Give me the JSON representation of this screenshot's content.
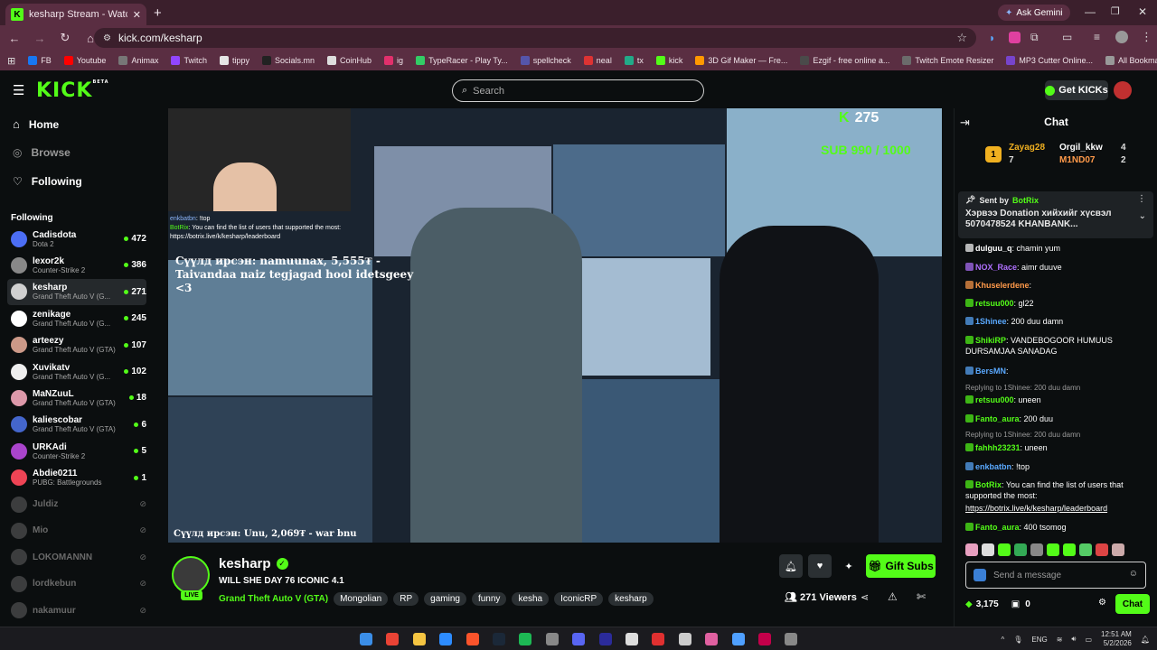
{
  "browser": {
    "tab_title": "kesharp Stream - Watch Liv",
    "tab_favicon": "K",
    "gemini": "Ask Gemini",
    "url": "kick.com/kesharp",
    "bookmarks": [
      "FB",
      "Youtube",
      "Animax",
      "Twitch",
      "tippy",
      "Socials.mn",
      "CoinHub",
      "ig",
      "TypeRacer - Play Ty...",
      "spellcheck",
      "neal",
      "tx",
      "kick",
      "3D Gif Maker — Fre...",
      "Ezgif - free online a...",
      "Twitch Emote Resizer",
      "MP3 Cutter Online...",
      "All Bookmarks"
    ],
    "bookmark_colors": [
      "#1877f2",
      "#ff0000",
      "#777",
      "#9146ff",
      "#e5e5e5",
      "#222",
      "#ddd",
      "#e1306c",
      "#3c6",
      "#55a",
      "#d33",
      "#2a8",
      "#53fc18",
      "#ff9800",
      "#4a4a4a",
      "#6b6b6b",
      "#7744cc",
      "#999"
    ]
  },
  "header": {
    "logo": "KICK",
    "logo_sup": "BETA",
    "search_placeholder": "Search",
    "get_kicks": "Get KICKs"
  },
  "sidebar": {
    "nav": [
      "Home",
      "Browse",
      "Following"
    ],
    "following_heading": "Following",
    "channels": [
      {
        "name": "Cadisdota",
        "game": "Dota 2",
        "viewers": "472",
        "color": "#4c6ef5"
      },
      {
        "name": "lexor2k",
        "game": "Counter-Strike 2",
        "viewers": "386",
        "color": "#888"
      },
      {
        "name": "kesharp",
        "game": "Grand Theft Auto V (G...",
        "viewers": "271",
        "color": "#d0d0d0"
      },
      {
        "name": "zenikage",
        "game": "Grand Theft Auto V (G...",
        "viewers": "245",
        "color": "#fff"
      },
      {
        "name": "arteezy",
        "game": "Grand Theft Auto V (GTA)",
        "viewers": "107",
        "color": "#c98"
      },
      {
        "name": "Xuvikatv",
        "game": "Grand Theft Auto V (G...",
        "viewers": "102",
        "color": "#eee"
      },
      {
        "name": "MaNZuuL",
        "game": "Grand Theft Auto V (GTA)",
        "viewers": "18",
        "color": "#d9a"
      },
      {
        "name": "kaliescobar",
        "game": "Grand Theft Auto V (GTA)",
        "viewers": "6",
        "color": "#46c"
      },
      {
        "name": "URKAdi",
        "game": "Counter-Strike 2",
        "viewers": "5",
        "color": "#a4c"
      },
      {
        "name": "Abdie0211",
        "game": "PUBG: Battlegrounds",
        "viewers": "1",
        "color": "#e45"
      }
    ],
    "offline": [
      "Juldiz",
      "Mio",
      "LOKOMANNN",
      "lordkebun",
      "nakamuur"
    ]
  },
  "video": {
    "kick_count": "275",
    "sub_goal": "SUB 990 / 1000",
    "donation_overlay": "Сүүлд ирсэн: namuunax, 5,555₮ - Taivandaa naiz tegjagad hool idetsgeey <3",
    "donation_bottom": "Сүүлд ирсэн: Unu, 2,069₮ - war bnu",
    "cam_chat": [
      {
        "user": "enkbatbn",
        "text": "!top"
      },
      {
        "user": "BotRix",
        "text": "You can find the list of users that supported the most: https://botrix.live/k/kesharp/leaderboard"
      }
    ]
  },
  "stream": {
    "streamer": "kesharp",
    "live": "LIVE",
    "title": "WILL SHE DAY 76 ICONIC 4.1",
    "category": "Grand Theft Auto V (GTA)",
    "tags": [
      "Mongolian",
      "RP",
      "gaming",
      "funny",
      "kesha",
      "IconicRP",
      "kesharp"
    ],
    "gift_subs": "Gift Subs",
    "viewers": "271 Viewers"
  },
  "chat": {
    "title": "Chat",
    "leaderboard": [
      {
        "rank": "1",
        "name": "Zayag28",
        "count": "7"
      },
      {
        "name": "Orgil_kkw",
        "count": "4"
      },
      {
        "name": "M1ND07",
        "count": "2"
      }
    ],
    "pinned": {
      "sent_by": "Sent by",
      "user": "BotRix",
      "text": "Хэрвээ Donation хийхийг хүсвэл 5070478524 KHANBANK..."
    },
    "messages": [
      {
        "user": "dulguu_q",
        "text": "chamin yum",
        "color": "#ffffff"
      },
      {
        "user": "NOX_Race",
        "text": "aimr duuve",
        "color": "#b070ff"
      },
      {
        "user": "Khuselerdene",
        "text": "",
        "color": "#ff9a4a"
      },
      {
        "user": "retsuu000",
        "text": "gl22",
        "color": "#53fc18"
      },
      {
        "user": "1Shinee",
        "text": "200 duu damn",
        "color": "#5aa9ff"
      },
      {
        "user": "ShikiRP",
        "text": "VANDEBOGOOR HUMUUS DURSAMJAA SANADAG",
        "color": "#53fc18"
      },
      {
        "user": "BersMN",
        "text": "",
        "color": "#5aa9ff"
      },
      {
        "user": "retsuu000",
        "text": "uneen",
        "color": "#53fc18"
      },
      {
        "user": "Fanto_aura",
        "text": "200 duu",
        "color": "#53fc18"
      },
      {
        "user": "fahhh23231",
        "text": "uneen",
        "color": "#53fc18"
      },
      {
        "user": "enkbatbn",
        "text": "!top",
        "color": "#5aa9ff"
      },
      {
        "user": "BotRix",
        "text": "You can find the list of users that supported the most:",
        "color": "#53fc18"
      },
      {
        "user": "Fanto_aura",
        "text": "400 tsomog",
        "color": "#53fc18"
      }
    ],
    "reply1": "Replying to 1Shinee: 200 duu damn",
    "reply2": "Replying to 1Shinee: 200 duu damn",
    "botrix_link": "https://botrix.live/k/kesharp/leaderboard",
    "input_placeholder": "Send a message",
    "points": "3,175",
    "gifts": "0",
    "send_label": "Chat"
  },
  "taskbar": {
    "lang": "ENG",
    "time": "12:51 AM",
    "date": "5/2/2026"
  }
}
